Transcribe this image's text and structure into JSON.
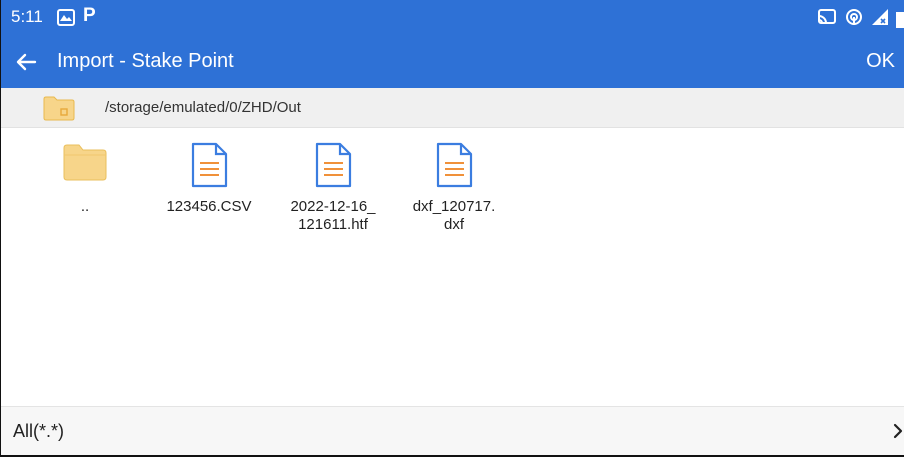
{
  "status_bar": {
    "time": "5:11",
    "notif_letter": "P",
    "icons": [
      "gallery-icon",
      "cast-icon",
      "hotspot-icon",
      "signal-icon",
      "battery-icon"
    ]
  },
  "app_bar": {
    "title": "Import - Stake Point",
    "ok_label": "OK",
    "color": "#2e71d6"
  },
  "path_bar": {
    "path": "/storage/emulated/0/ZHD/Out"
  },
  "files": [
    {
      "name": "..",
      "type": "folder"
    },
    {
      "name": "123456.CSV",
      "type": "file"
    },
    {
      "name": "2022-12-16_121611.htf",
      "type": "file"
    },
    {
      "name": "dxf_120717.dxf",
      "type": "file"
    }
  ],
  "filter": {
    "label": "All(*.*)"
  },
  "colors": {
    "accent": "#2e71d6",
    "folder": "#f7d58a",
    "file_outline": "#3b7de0",
    "file_lines": "#f0913a"
  }
}
